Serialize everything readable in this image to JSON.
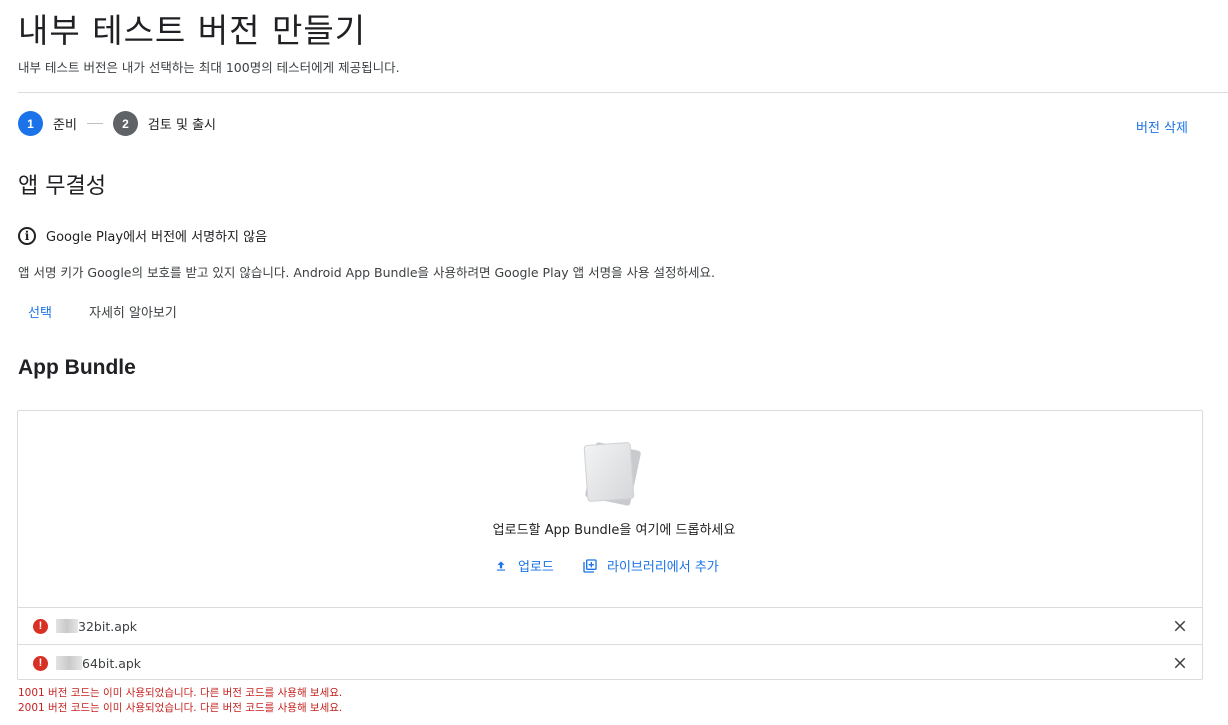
{
  "page": {
    "title": "내부 테스트 버전 만들기",
    "subtitle": "내부 테스트 버전은 내가 선택하는 최대 100명의 테스터에게 제공됩니다."
  },
  "stepper": {
    "steps": [
      {
        "number": "1",
        "label": "준비",
        "state": "active"
      },
      {
        "number": "2",
        "label": "검토 및 출시",
        "state": "idle"
      }
    ]
  },
  "header_actions": {
    "delete_version": "버전 삭제"
  },
  "app_integrity": {
    "title": "앱 무결성",
    "info_icon": "info-icon",
    "info_title": "Google Play에서 버전에 서명하지 않음",
    "description": "앱 서명 키가 Google의 보호를 받고 있지 않습니다. Android App Bundle을 사용하려면 Google Play 앱 서명을 사용 설정하세요.",
    "select_label": "선택",
    "learn_more_label": "자세히 알아보기"
  },
  "app_bundle": {
    "title": "App Bundle",
    "drop_text": "업로드할 App Bundle을 여기에 드롭하세요",
    "upload_label": "업로드",
    "library_label": "라이브러리에서 추가",
    "files": [
      {
        "name": "32bit.apk",
        "status": "error"
      },
      {
        "name": "64bit.apk",
        "status": "error"
      }
    ],
    "errors": [
      "1001 버전 코드는 이미 사용되었습니다. 다른 버전 코드를 사용해 보세요.",
      "2001 버전 코드는 이미 사용되었습니다. 다른 버전 코드를 사용해 보세요."
    ]
  },
  "colors": {
    "accent": "#1a73e8",
    "error": "#d93025",
    "text": "#202124",
    "divider": "#dadce0"
  }
}
